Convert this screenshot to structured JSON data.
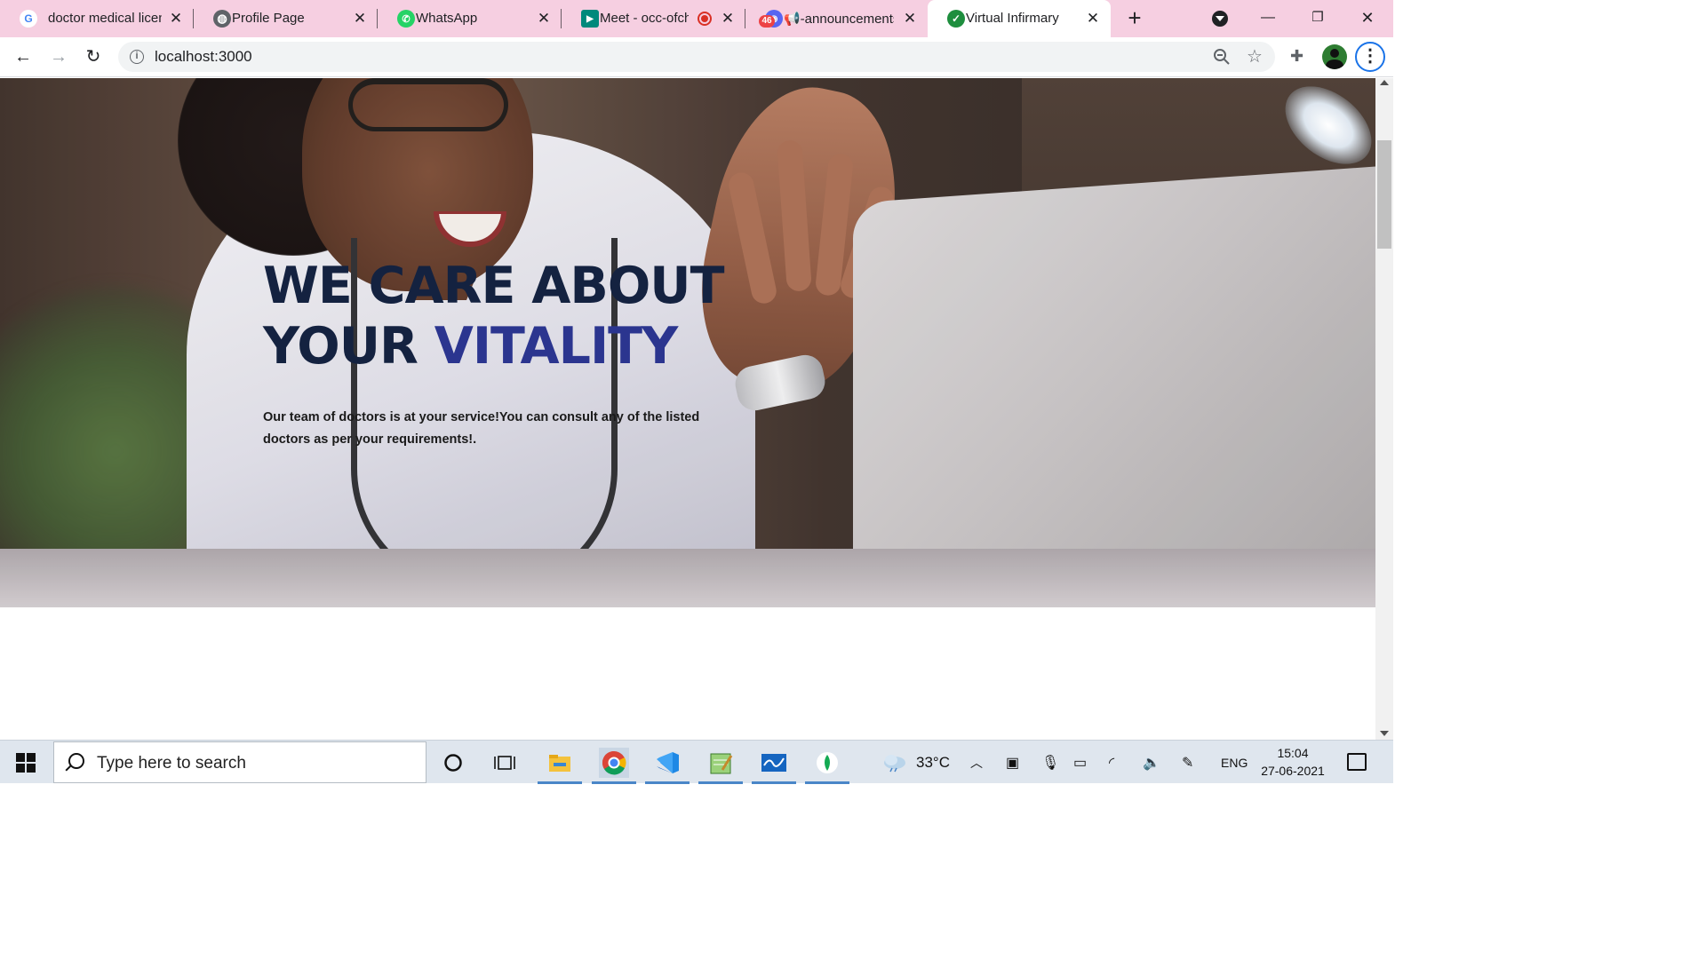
{
  "browser": {
    "tabs": [
      {
        "title": "doctor medical licen",
        "favicon": "google-icon"
      },
      {
        "title": "Profile Page",
        "favicon": "globe-icon"
      },
      {
        "title": "WhatsApp",
        "favicon": "whatsapp-icon"
      },
      {
        "title": "Meet - occ-ofch",
        "favicon": "google-meet-icon",
        "recording": true
      },
      {
        "title": "📢-announcements",
        "favicon": "discord-icon",
        "badge": "46"
      },
      {
        "title": "Virtual Infirmary",
        "favicon": "check-circle-icon",
        "active": true
      }
    ],
    "url": "localhost:3000"
  },
  "hero": {
    "title_line1": "WE CARE ABOUT",
    "title_line2_prefix": "YOUR",
    "title_line2_accent": "VITALITY",
    "description": "Our team of doctors is at your service!You can consult any of the listed doctors as per your requirements!.",
    "colors": {
      "title": "#142240",
      "accent": "#2b358f"
    }
  },
  "taskbar": {
    "search_placeholder": "Type here to search",
    "weather": "33°C",
    "language": "ENG",
    "time": "15:04",
    "date": "27-06-2021",
    "apps": [
      "cortana-icon",
      "task-view-icon",
      "file-explorer-icon",
      "chrome-icon",
      "vscode-icon",
      "notepad-icon",
      "whiteboard-icon",
      "mongodb-icon"
    ]
  }
}
